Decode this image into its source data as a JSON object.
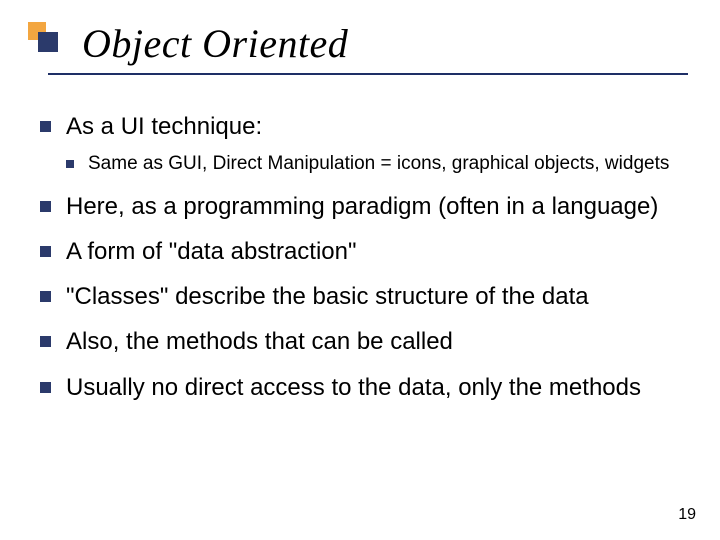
{
  "title": "Object Oriented",
  "bullets": [
    {
      "text": "As a UI technique:",
      "children": [
        "Same as GUI, Direct Manipulation = icons, graphical objects, widgets"
      ]
    },
    {
      "text": "Here, as a programming paradigm (often in a language)"
    },
    {
      "text": "A form of \"data abstraction\""
    },
    {
      "text": "\"Classes\" describe the basic structure of the data"
    },
    {
      "text": "Also, the methods that can be called"
    },
    {
      "text": "Usually no direct access to the data, only the methods"
    }
  ],
  "page_number": "19"
}
